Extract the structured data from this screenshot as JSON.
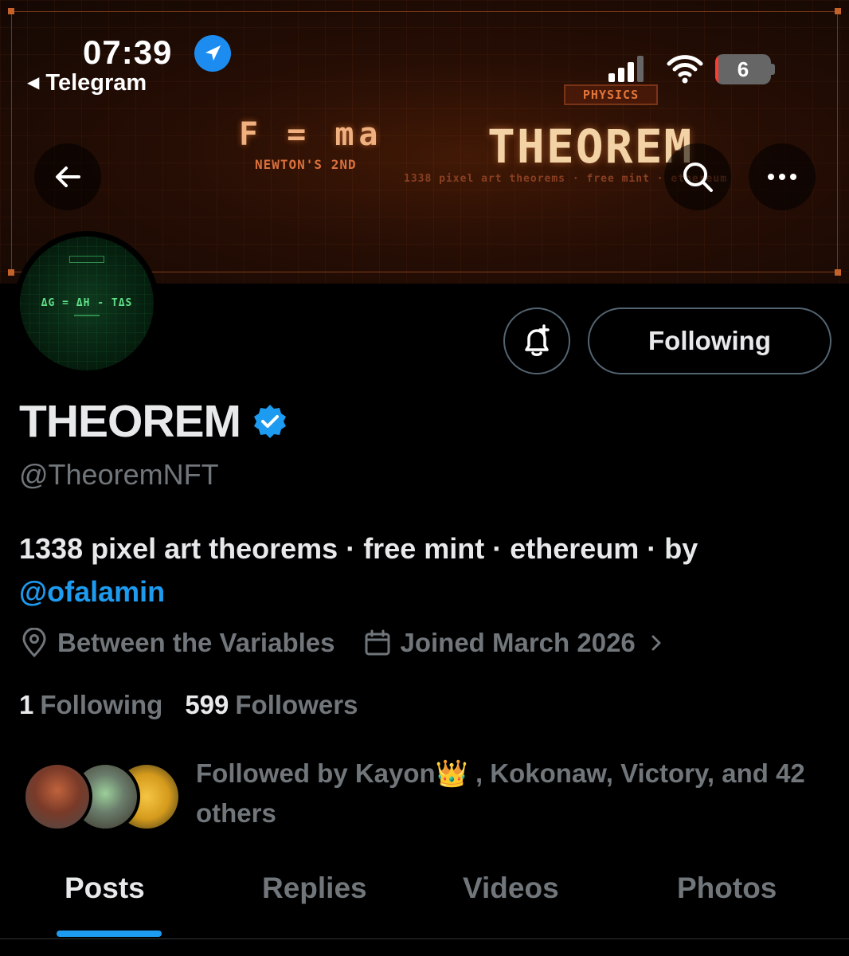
{
  "status_bar": {
    "time": "07:39",
    "back_app": "Telegram",
    "battery": "6",
    "battery_level": 0.06
  },
  "banner": {
    "tag": "PHYSICS",
    "formula": "F = ma",
    "formula_caption": "NEWTON'S 2ND",
    "title": "THEOREM",
    "tagline": "1338 pixel art theorems · free mint · ethereum"
  },
  "avatar": {
    "formula": "ΔG = ΔH - TΔS"
  },
  "actions": {
    "following_label": "Following"
  },
  "profile": {
    "display_name": "THEOREM",
    "handle": "@TheoremNFT",
    "bio_text": "1338 pixel art theorems · free mint · ethereum · by ",
    "bio_mention": "@ofalamin",
    "location": "Between the Variables",
    "joined": "Joined March 2026"
  },
  "stats": {
    "following_count": "1",
    "following_label": "Following",
    "followers_count": "599",
    "followers_label": "Followers"
  },
  "followed_by": {
    "text": "Followed by Kayon👑 , Kokonaw, Victory, and 42 others"
  },
  "tabs": [
    {
      "label": "Posts",
      "active": true
    },
    {
      "label": "Replies",
      "active": false
    },
    {
      "label": "Videos",
      "active": false
    },
    {
      "label": "Photos",
      "active": false
    }
  ],
  "colors": {
    "accent": "#1d9bf0",
    "muted_text": "#71767b",
    "primary_text": "#e7e9ea"
  }
}
